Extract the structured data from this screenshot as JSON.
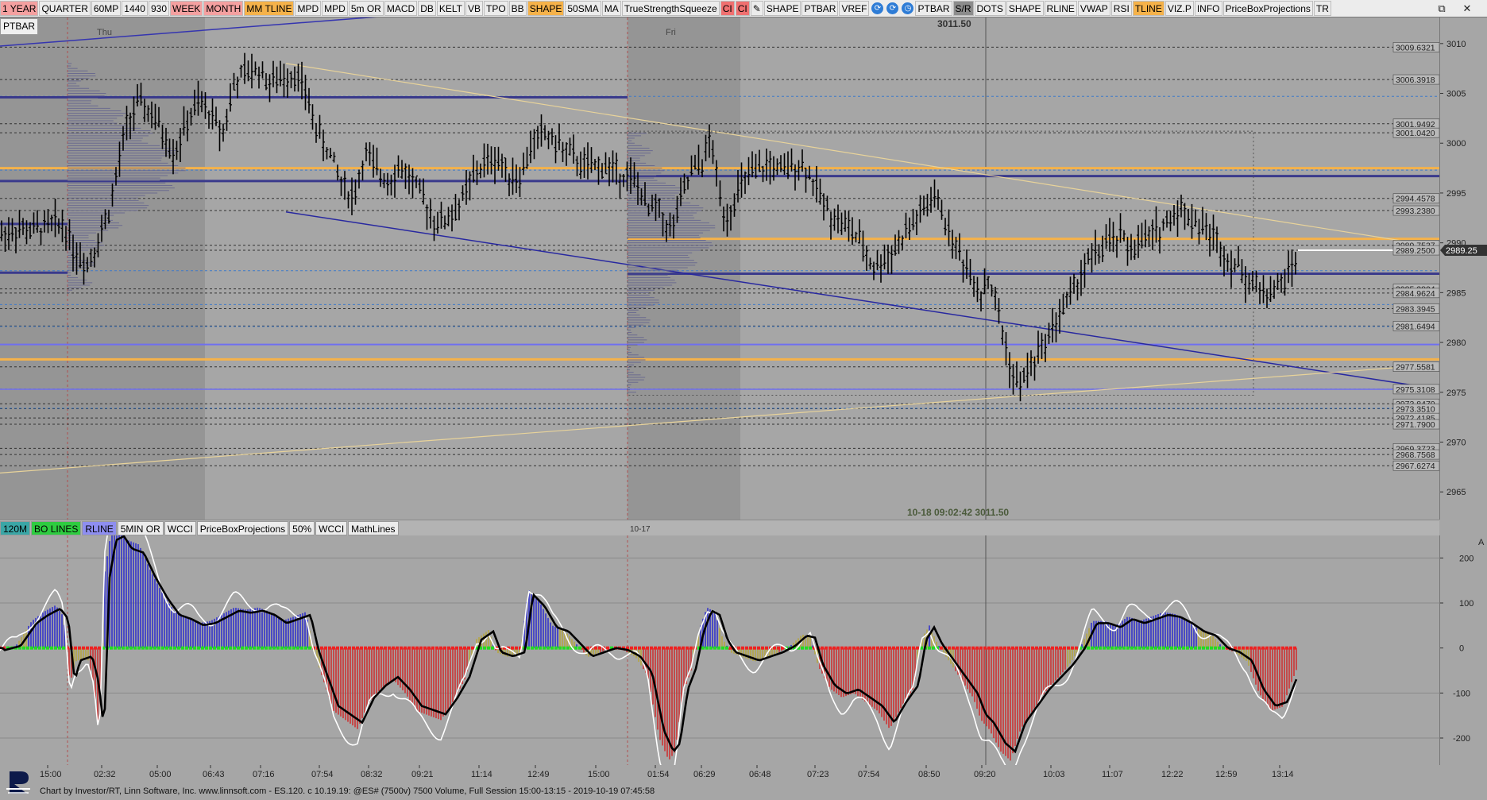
{
  "toolbar": {
    "buttons": [
      {
        "label": "1 YEAR",
        "bg": "#f4a0a0"
      },
      {
        "label": "QUARTER",
        "bg": "#ececec"
      },
      {
        "label": "60MP",
        "bg": "#ececec"
      },
      {
        "label": "1440",
        "bg": "#ececec"
      },
      {
        "label": "930",
        "bg": "#ececec"
      },
      {
        "label": "WEEK",
        "bg": "#f4a0a0"
      },
      {
        "label": "MONTH",
        "bg": "#f4a0a0"
      },
      {
        "label": "MM TLINE",
        "bg": "#f5b24a"
      },
      {
        "label": "MPD",
        "bg": "#ececec"
      },
      {
        "label": "MPD",
        "bg": "#ececec"
      },
      {
        "label": "5m OR",
        "bg": "#ececec"
      },
      {
        "label": "MACD",
        "bg": "#ececec"
      },
      {
        "label": "DB",
        "bg": "#ececec"
      },
      {
        "label": "KELT",
        "bg": "#ececec"
      },
      {
        "label": "VB",
        "bg": "#ececec"
      },
      {
        "label": "TPO",
        "bg": "#ececec"
      },
      {
        "label": "BB",
        "bg": "#ececec"
      },
      {
        "label": "SHAPE",
        "bg": "#f5b24a"
      },
      {
        "label": "50SMA",
        "bg": "#ececec"
      },
      {
        "label": "MA",
        "bg": "#ececec"
      },
      {
        "label": "TrueStrengthSqueeze",
        "bg": "#ececec"
      },
      {
        "label": "CI",
        "bg": "#f07070"
      },
      {
        "label": "CI",
        "bg": "#f07070"
      },
      {
        "label": "✎",
        "bg": "#ececec"
      },
      {
        "label": "SHAPE",
        "bg": "#ececec"
      },
      {
        "label": "PTBAR",
        "bg": "#ececec"
      },
      {
        "label": "VREF",
        "bg": "#ececec"
      }
    ],
    "buttons2": [
      {
        "label": "PTBAR",
        "bg": "#ececec"
      },
      {
        "label": "S/R",
        "bg": "#8c8c8c"
      },
      {
        "label": "DOTS",
        "bg": "#ececec"
      },
      {
        "label": "SHAPE",
        "bg": "#ececec"
      },
      {
        "label": "RLINE",
        "bg": "#ececec"
      },
      {
        "label": "VWAP",
        "bg": "#ececec"
      },
      {
        "label": "RSI",
        "bg": "#ececec"
      },
      {
        "label": "TLINE",
        "bg": "#f5b24a"
      },
      {
        "label": "VIZ.P",
        "bg": "#ececec"
      },
      {
        "label": "INFO",
        "bg": "#ececec"
      },
      {
        "label": "PriceBoxProjections",
        "bg": "#ececec"
      },
      {
        "label": "TR",
        "bg": "#ececec"
      }
    ],
    "icons": [
      "refresh-icon",
      "refresh-icon",
      "clock-icon"
    ],
    "window_controls": [
      "⧉",
      "✕"
    ]
  },
  "price_pane": {
    "label": "PTBAR",
    "day_labels": [
      "Thu",
      "Fri"
    ],
    "top_price": "3011.50",
    "cursor_readout": "10-18 09:02:42  3011.50",
    "axis_ticks": [
      "3010",
      "3005",
      "3000",
      "2995",
      "2990",
      "2985",
      "2980",
      "2975",
      "2970",
      "2965"
    ],
    "axis_range": [
      2963.5,
      3011.5
    ],
    "current_price": "2989.25",
    "level_labels": [
      {
        "text": "3009.6321",
        "price": 3009.6321
      },
      {
        "text": "3006.3918",
        "price": 3006.3918
      },
      {
        "text": "3001.9492",
        "price": 3001.9492
      },
      {
        "text": "3001.0420",
        "price": 3001.042
      },
      {
        "text": "2994.4578",
        "price": 2994.4578
      },
      {
        "text": "2993.2380",
        "price": 2993.238
      },
      {
        "text": "2989.7537",
        "price": 2989.7537
      },
      {
        "text": "2989.2500",
        "price": 2989.25
      },
      {
        "text": "2985.3804",
        "price": 2985.3804
      },
      {
        "text": "2984.9624",
        "price": 2984.9624
      },
      {
        "text": "2983.3945",
        "price": 2983.3945
      },
      {
        "text": "2981.6494",
        "price": 2981.6494
      },
      {
        "text": "2977.5581",
        "price": 2977.5581
      },
      {
        "text": "2975.3108",
        "price": 2975.3108
      },
      {
        "text": "2973.8470",
        "price": 2973.847
      },
      {
        "text": "2973.3510",
        "price": 2973.351
      },
      {
        "text": "2972.4185",
        "price": 2972.4185
      },
      {
        "text": "2971.7900",
        "price": 2971.79
      },
      {
        "text": "2969.3723",
        "price": 2969.3723
      },
      {
        "text": "2968.7568",
        "price": 2968.7568
      },
      {
        "text": "2967.6274",
        "price": 2967.6274
      }
    ]
  },
  "indicator_bar": {
    "buttons": [
      {
        "label": "120M",
        "bg": "#3aa6a6"
      },
      {
        "label": "BO LINES",
        "bg": "#2ecc40"
      },
      {
        "label": "RLINE",
        "bg": "#8e8ef0"
      },
      {
        "label": "5MIN OR",
        "bg": "#ececec"
      },
      {
        "label": "WCCI",
        "bg": "#ececec"
      },
      {
        "label": "PriceBoxProjections",
        "bg": "#ececec"
      },
      {
        "label": "50%",
        "bg": "#ececec"
      },
      {
        "label": "WCCI",
        "bg": "#ececec"
      },
      {
        "label": "MathLines",
        "bg": "#ececec"
      }
    ],
    "date_label": "10-17"
  },
  "cci_pane": {
    "axis_ticks": [
      "200",
      "100",
      "0",
      "-100",
      "-200"
    ],
    "axis_range": [
      -260,
      250
    ],
    "corner_label": "A"
  },
  "time_axis": {
    "labels": [
      "15:00",
      "02:32",
      "05:00",
      "06:43",
      "07:16",
      "07:54",
      "08:32",
      "09:21",
      "11:14",
      "12:49",
      "15:00",
      "01:54",
      "06:29",
      "06:48",
      "07:23",
      "07:54",
      "08:50",
      "09:20",
      "10:03",
      "11:07",
      "12:22",
      "12:59",
      "13:14"
    ]
  },
  "status_text": "Chart by Investor/RT, Linn Software, Inc. www.linnsoft.com - ES.120. c   10.19.19: @ES# (7500v) 7500 Volume, Full Session 15:00-13:15 - 2019-10-19 07:45:58",
  "colors": {
    "bg": "#a6a6a6",
    "bar": "#000000",
    "orange_line": "#f5b24a",
    "navy_line": "#3a3a8c",
    "cci_pos": "#3333cc",
    "cci_neg": "#cc3333",
    "cci_neutral": "#b5a642",
    "zero_green": "#22dd22",
    "zero_red": "#ee2222"
  }
}
